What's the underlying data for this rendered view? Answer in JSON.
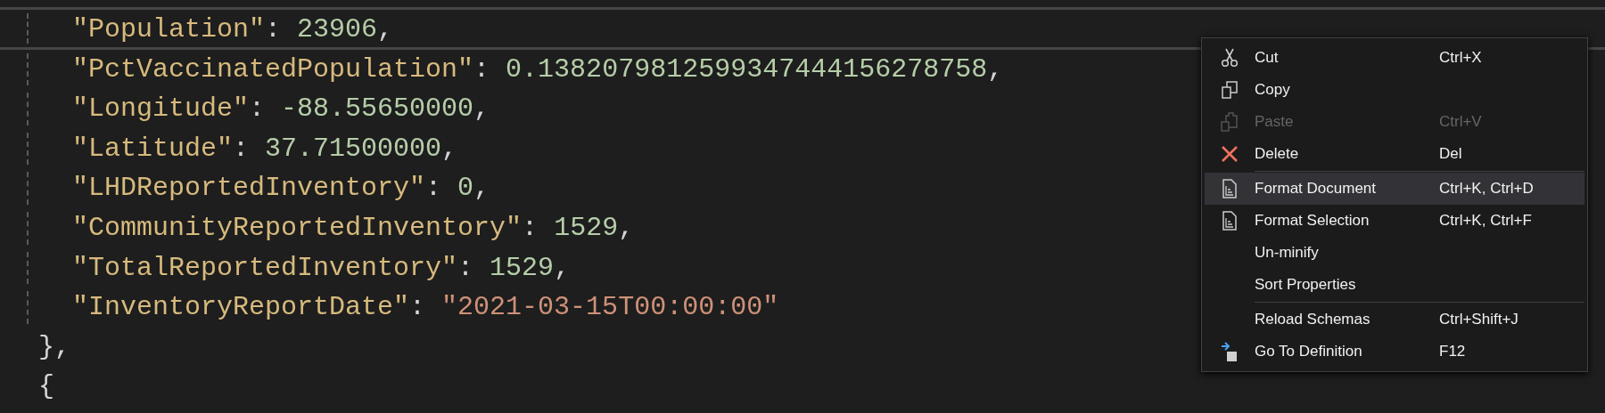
{
  "editor": {
    "lines": [
      {
        "selected": true,
        "kind": "property",
        "tokens": [
          {
            "kind": "key",
            "text": "\"Population\""
          },
          {
            "kind": "punct",
            "text": ": "
          },
          {
            "kind": "number",
            "text": "23906"
          },
          {
            "kind": "punct",
            "text": ","
          }
        ]
      },
      {
        "selected": false,
        "kind": "property",
        "tokens": [
          {
            "kind": "key",
            "text": "\"PctVaccinatedPopulation\""
          },
          {
            "kind": "punct",
            "text": ": "
          },
          {
            "kind": "number",
            "text": "0.1382079812599347444156278758"
          },
          {
            "kind": "punct",
            "text": ","
          }
        ]
      },
      {
        "selected": false,
        "kind": "property",
        "tokens": [
          {
            "kind": "key",
            "text": "\"Longitude\""
          },
          {
            "kind": "punct",
            "text": ": "
          },
          {
            "kind": "number",
            "text": "-88.55650000"
          },
          {
            "kind": "punct",
            "text": ","
          }
        ]
      },
      {
        "selected": false,
        "kind": "property",
        "tokens": [
          {
            "kind": "key",
            "text": "\"Latitude\""
          },
          {
            "kind": "punct",
            "text": ": "
          },
          {
            "kind": "number",
            "text": "37.71500000"
          },
          {
            "kind": "punct",
            "text": ","
          }
        ]
      },
      {
        "selected": false,
        "kind": "property",
        "tokens": [
          {
            "kind": "key",
            "text": "\"LHDReportedInventory\""
          },
          {
            "kind": "punct",
            "text": ": "
          },
          {
            "kind": "number",
            "text": "0"
          },
          {
            "kind": "punct",
            "text": ","
          }
        ]
      },
      {
        "selected": false,
        "kind": "property",
        "tokens": [
          {
            "kind": "key",
            "text": "\"CommunityReportedInventory\""
          },
          {
            "kind": "punct",
            "text": ": "
          },
          {
            "kind": "number",
            "text": "1529"
          },
          {
            "kind": "punct",
            "text": ","
          }
        ]
      },
      {
        "selected": false,
        "kind": "property",
        "tokens": [
          {
            "kind": "key",
            "text": "\"TotalReportedInventory\""
          },
          {
            "kind": "punct",
            "text": ": "
          },
          {
            "kind": "number",
            "text": "1529"
          },
          {
            "kind": "punct",
            "text": ","
          }
        ]
      },
      {
        "selected": false,
        "kind": "property",
        "tokens": [
          {
            "kind": "key",
            "text": "\"InventoryReportDate\""
          },
          {
            "kind": "punct",
            "text": ": "
          },
          {
            "kind": "string",
            "text": "\"2021-03-15T00:00:00\""
          }
        ]
      },
      {
        "selected": false,
        "kind": "bracket",
        "tokens": [
          {
            "kind": "punct",
            "text": "},"
          }
        ]
      },
      {
        "selected": false,
        "kind": "bracket",
        "tokens": [
          {
            "kind": "punct",
            "text": "{"
          }
        ]
      }
    ]
  },
  "context_menu": {
    "items": [
      {
        "kind": "cut",
        "label": "Cut",
        "shortcut": "Ctrl+X",
        "disabled": false,
        "selected": false,
        "separator_before": false
      },
      {
        "kind": "copy",
        "label": "Copy",
        "disabled": false,
        "selected": false,
        "separator_before": false
      },
      {
        "kind": "paste",
        "label": "Paste",
        "shortcut": "Ctrl+V",
        "disabled": true,
        "selected": false,
        "separator_before": false
      },
      {
        "kind": "delete",
        "label": "Delete",
        "shortcut": "Del",
        "disabled": false,
        "selected": false,
        "separator_before": false
      },
      {
        "kind": "format",
        "label": "Format Document",
        "shortcut": "Ctrl+K, Ctrl+D",
        "disabled": false,
        "selected": true,
        "separator_before": true
      },
      {
        "kind": "format",
        "label": "Format Selection",
        "shortcut": "Ctrl+K, Ctrl+F",
        "disabled": false,
        "selected": false,
        "separator_before": false
      },
      {
        "kind": "plain",
        "label": "Un-minify",
        "disabled": false,
        "selected": false,
        "separator_before": false
      },
      {
        "kind": "plain",
        "label": "Sort Properties",
        "disabled": false,
        "selected": false,
        "separator_before": false
      },
      {
        "kind": "plain",
        "label": "Reload Schemas",
        "shortcut": "Ctrl+Shift+J",
        "disabled": false,
        "selected": false,
        "separator_before": true
      },
      {
        "kind": "goto",
        "label": "Go To Definition",
        "shortcut": "F12",
        "disabled": false,
        "selected": false,
        "separator_before": false
      }
    ]
  }
}
